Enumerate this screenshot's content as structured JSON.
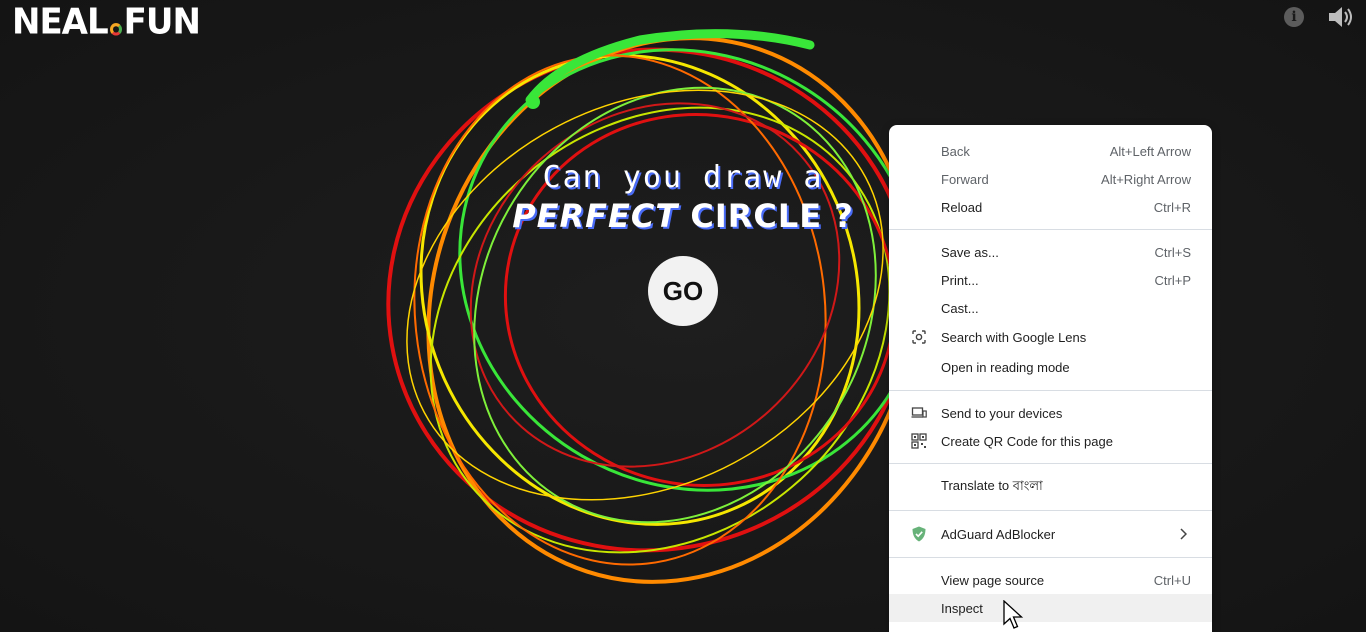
{
  "site": {
    "logo_left": "NEAL",
    "logo_right": "FUN"
  },
  "header": {
    "info_icon": "info-icon",
    "sound_icon": "speaker-icon",
    "info_glyph": "i"
  },
  "hero": {
    "line1": "Can you draw a",
    "line2_em": "PERFECT",
    "line2_rest": "CIRCLE ?",
    "go_label": "GO"
  },
  "colors": {
    "red": "#e01010",
    "orange": "#ff8800",
    "yellow": "#f5e700",
    "green": "#39e639"
  },
  "context_menu": {
    "back": {
      "label": "Back",
      "shortcut": "Alt+Left Arrow"
    },
    "forward": {
      "label": "Forward",
      "shortcut": "Alt+Right Arrow"
    },
    "reload": {
      "label": "Reload",
      "shortcut": "Ctrl+R"
    },
    "save_as": {
      "label": "Save as...",
      "shortcut": "Ctrl+S"
    },
    "print": {
      "label": "Print...",
      "shortcut": "Ctrl+P"
    },
    "cast": {
      "label": "Cast..."
    },
    "lens": {
      "label": "Search with Google Lens",
      "icon": "google-lens-icon"
    },
    "reading_mode": {
      "label": "Open in reading mode"
    },
    "send_devices": {
      "label": "Send to your devices",
      "icon": "devices-icon"
    },
    "qr_code": {
      "label": "Create QR Code for this page",
      "icon": "qr-code-icon"
    },
    "translate": {
      "label": "Translate to বাংলা"
    },
    "adguard": {
      "label": "AdGuard AdBlocker",
      "icon": "adguard-shield-icon"
    },
    "view_source": {
      "label": "View page source",
      "shortcut": "Ctrl+U"
    },
    "inspect": {
      "label": "Inspect"
    }
  }
}
